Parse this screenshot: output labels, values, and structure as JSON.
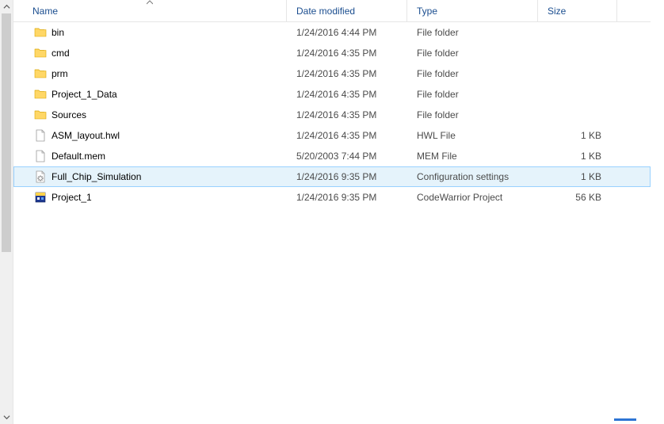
{
  "columns": {
    "name": "Name",
    "date": "Date modified",
    "type": "Type",
    "size": "Size"
  },
  "sort": {
    "column": "name",
    "direction": "asc"
  },
  "selectedIndex": 7,
  "rows": [
    {
      "icon": "folder",
      "name": "bin",
      "date": "1/24/2016 4:44 PM",
      "type": "File folder",
      "size": ""
    },
    {
      "icon": "folder",
      "name": "cmd",
      "date": "1/24/2016 4:35 PM",
      "type": "File folder",
      "size": ""
    },
    {
      "icon": "folder",
      "name": "prm",
      "date": "1/24/2016 4:35 PM",
      "type": "File folder",
      "size": ""
    },
    {
      "icon": "folder",
      "name": "Project_1_Data",
      "date": "1/24/2016 4:35 PM",
      "type": "File folder",
      "size": ""
    },
    {
      "icon": "folder",
      "name": "Sources",
      "date": "1/24/2016 4:35 PM",
      "type": "File folder",
      "size": ""
    },
    {
      "icon": "file",
      "name": "ASM_layout.hwl",
      "date": "1/24/2016 4:35 PM",
      "type": "HWL File",
      "size": "1 KB"
    },
    {
      "icon": "file",
      "name": "Default.mem",
      "date": "5/20/2003 7:44 PM",
      "type": "MEM File",
      "size": "1 KB"
    },
    {
      "icon": "config",
      "name": "Full_Chip_Simulation",
      "date": "1/24/2016 9:35 PM",
      "type": "Configuration settings",
      "size": "1 KB"
    },
    {
      "icon": "project",
      "name": "Project_1",
      "date": "1/24/2016 9:35 PM",
      "type": "CodeWarrior Project",
      "size": "56 KB"
    }
  ]
}
